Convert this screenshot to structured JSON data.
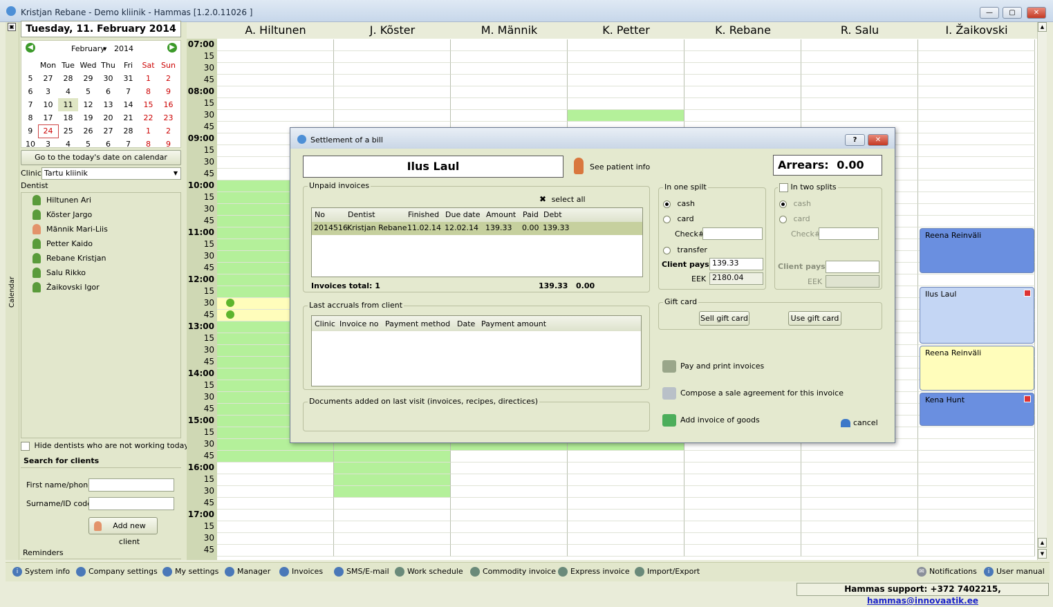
{
  "window": {
    "title": "Kristjan Rebane - Demo kliinik - Hammas [1.2.0.11026 ]"
  },
  "left": {
    "vertical_label": "Calendar",
    "date_header": "Tuesday, 11. February 2014",
    "calendar": {
      "month": "February",
      "year": "2014",
      "weekdays": [
        "Mon",
        "Tue",
        "Wed",
        "Thu",
        "Fri",
        "Sat",
        "Sun"
      ],
      "weeks": [
        {
          "wk": "5",
          "days": [
            "27",
            "28",
            "29",
            "30",
            "31",
            "1",
            "2"
          ]
        },
        {
          "wk": "6",
          "days": [
            "3",
            "4",
            "5",
            "6",
            "7",
            "8",
            "9"
          ]
        },
        {
          "wk": "7",
          "days": [
            "10",
            "11",
            "12",
            "13",
            "14",
            "15",
            "16"
          ]
        },
        {
          "wk": "8",
          "days": [
            "17",
            "18",
            "19",
            "20",
            "21",
            "22",
            "23"
          ]
        },
        {
          "wk": "9",
          "days": [
            "24",
            "25",
            "26",
            "27",
            "28",
            "1",
            "2"
          ]
        },
        {
          "wk": "10",
          "days": [
            "3",
            "4",
            "5",
            "6",
            "7",
            "8",
            "9"
          ]
        }
      ]
    },
    "goto_today": "Go to the today's date on calendar",
    "clinic_label": "Clinic",
    "clinic_value": "Tartu kliinik",
    "dentist_label": "Dentist",
    "dentists": [
      "Hiltunen Ari",
      "Kõster Jargo",
      "Männik Mari-Liis",
      "Petter Kaido",
      "Rebane Kristjan",
      "Salu Rikko",
      "Žaikovski Igor"
    ],
    "hide_label": "Hide dentists who are not working today",
    "search_title": "Search for clients",
    "first_name_label": "First name/phone",
    "surname_label": "Surname/ID code",
    "add_client": "Add new client",
    "reminders": "Reminders"
  },
  "schedule": {
    "columns": [
      "A. Hiltunen",
      "J. Kõster",
      "M. Männik",
      "K. Petter",
      "K. Rebane",
      "R. Salu",
      "I. Žaikovski"
    ],
    "times": [
      "07:00",
      "15",
      "30",
      "45",
      "08:00",
      "15",
      "30",
      "45",
      "09:00",
      "15",
      "30",
      "45",
      "10:00",
      "15",
      "30",
      "45",
      "11:00",
      "15",
      "30",
      "45",
      "12:00",
      "15",
      "30",
      "45",
      "13:00",
      "15",
      "30",
      "45",
      "14:00",
      "15",
      "30",
      "45",
      "15:00",
      "15",
      "30",
      "45",
      "16:00",
      "15",
      "30",
      "45",
      "17:00",
      "15",
      "30",
      "45"
    ],
    "appointments": [
      {
        "name": "Reena Reinväli",
        "color": "#6a8fe0"
      },
      {
        "name": "Ilus Laul",
        "color": "#c4d6f4"
      },
      {
        "name": "Reena Reinväli",
        "color": "#fffdbb"
      },
      {
        "name": "Kena Hunt",
        "color": "#6a8fe0"
      }
    ]
  },
  "dialog": {
    "title": "Settlement of a bill",
    "help": "?",
    "patient_name": "Ilus Laul",
    "see_patient": "See patient info",
    "arrears_label": "Arrears:",
    "arrears_value": "0.00",
    "unpaid_title": "Unpaid invoices",
    "select_all": "select all",
    "inv_headers": [
      "No",
      "Dentist",
      "Finished",
      "Due date",
      "Amount",
      "Paid",
      "Debt"
    ],
    "inv_rows": [
      [
        "2014516",
        "Kristjan Rebane",
        "11.02.14",
        "12.02.14",
        "139.33",
        "0.00",
        "139.33"
      ]
    ],
    "invoices_total_label": "Invoices total:",
    "invoices_total_count": "1",
    "invoices_total_amount": "139.33",
    "invoices_total_paid": "0.00",
    "accruals_title": "Last accruals from client",
    "acc_headers": [
      "Clinic",
      "Invoice no",
      "Payment method",
      "Date",
      "Payment amount"
    ],
    "documents_title": "Documents added on last visit (invoices, recipes, directices)",
    "one_split": "In one spilt",
    "cash": "cash",
    "card": "card",
    "check": "Check#",
    "transfer": "transfer",
    "client_pays": "Client pays",
    "client_pays_value": "139.33",
    "eek": "EEK",
    "eek_value": "2180.04",
    "two_splits": "In two splits",
    "gift_title": "Gift card",
    "sell_gift": "Sell gift card",
    "use_gift": "Use gift card",
    "pay_print": "Pay and print invoices",
    "compose": "Compose a sale agreement for this invoice",
    "add_goods": "Add invoice of goods",
    "cancel": "cancel"
  },
  "bottom": {
    "items": [
      "System info",
      "Company settings",
      "My settings",
      "Manager",
      "Invoices",
      "SMS/E-mail",
      "Work schedule",
      "Commodity invoice",
      "Express invoice",
      "Import/Export"
    ],
    "notifications": "Notifications",
    "manual": "User manual",
    "support_text": "Hammas support: +372 7402215,",
    "support_email": "hammas@innovaatik.ee"
  }
}
